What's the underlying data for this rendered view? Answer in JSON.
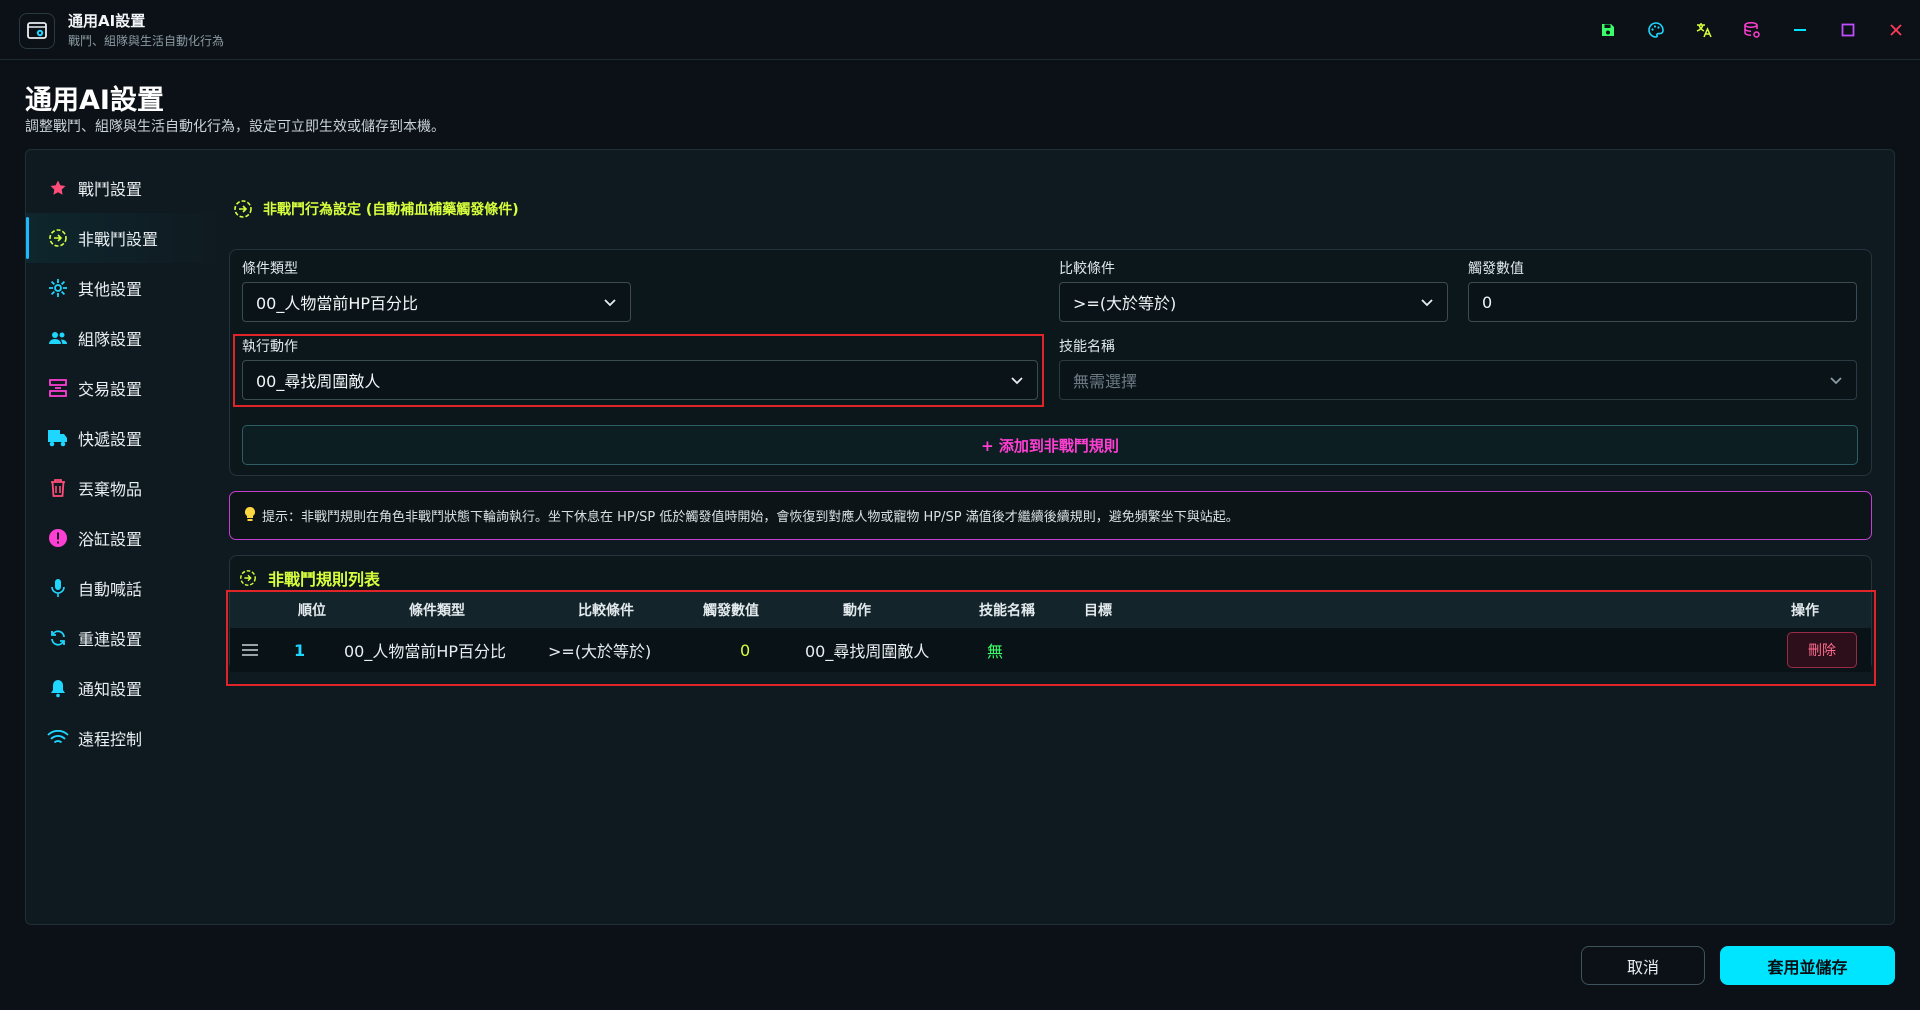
{
  "window": {
    "title": "通用AI設置",
    "subtitle": "戰鬥、組隊與生活自動化行為",
    "icons": [
      "save-icon",
      "palette-icon",
      "translate-icon",
      "database-settings-icon",
      "minimize-icon",
      "maximize-icon",
      "close-icon"
    ],
    "icon_colors": {
      "save": "#39ff6a",
      "palette": "#1fd6ff",
      "translate": "#d8ff3c",
      "database": "#ff3fd4",
      "minimize": "#00e5ff",
      "maximize": "#c04dff",
      "close": "#ff3b5c"
    }
  },
  "page": {
    "title": "通用AI設置",
    "description": "調整戰鬥、組隊與生活自動化行為，設定可立即生效或儲存到本機。"
  },
  "sidebar": {
    "active_index": 1,
    "items": [
      {
        "label": "戰鬥設置",
        "icon": "star-icon",
        "color": "#ff4d7a"
      },
      {
        "label": "非戰鬥設置",
        "icon": "circle-arrow-icon",
        "color": "#d8ff3c"
      },
      {
        "label": "其他設置",
        "icon": "gear-burst-icon",
        "color": "#1fd6ff"
      },
      {
        "label": "組隊設置",
        "icon": "group-icon",
        "color": "#1fd6ff"
      },
      {
        "label": "交易設置",
        "icon": "exchange-icon",
        "color": "#ff3fd4"
      },
      {
        "label": "快遞設置",
        "icon": "truck-icon",
        "color": "#1fd6ff"
      },
      {
        "label": "丟棄物品",
        "icon": "trash-icon",
        "color": "#ff4d7a"
      },
      {
        "label": "浴缸設置",
        "icon": "alert-icon",
        "color": "#ff3fd4"
      },
      {
        "label": "自動喊話",
        "icon": "mic-icon",
        "color": "#1fd6ff"
      },
      {
        "label": "重連設置",
        "icon": "refresh-icon",
        "color": "#1fd6ff"
      },
      {
        "label": "通知設置",
        "icon": "bell-icon",
        "color": "#1fd6ff"
      },
      {
        "label": "遠程控制",
        "icon": "wifi-icon",
        "color": "#1fd6ff"
      }
    ]
  },
  "section": {
    "title": "非戰鬥行為設定 (自動補血補藥觸發條件)"
  },
  "form": {
    "condition_type": {
      "label": "條件類型",
      "value": "00_人物當前HP百分比"
    },
    "compare": {
      "label": "比較條件",
      "value": ">=(大於等於)"
    },
    "trigger": {
      "label": "觸發數值",
      "value": "0"
    },
    "action": {
      "label": "執行動作",
      "value": "00_尋找周圍敵人"
    },
    "skill": {
      "label": "技能名稱",
      "placeholder": "無需選擇"
    },
    "add_button": "+ 添加到非戰鬥規則"
  },
  "hint": {
    "icon": "lightbulb-icon",
    "text": "提示：非戰鬥規則在角色非戰鬥狀態下輪詢執行。坐下休息在 HP/SP 低於觸發值時開始，會恢復到對應人物或寵物 HP/SP 滿值後才繼續後續規則，避免頻繁坐下與站起。"
  },
  "rules": {
    "title": "非戰鬥規則列表",
    "columns": [
      "順位",
      "條件類型",
      "比較條件",
      "觸發數值",
      "動作",
      "技能名稱",
      "目標",
      "操作"
    ],
    "rows": [
      {
        "order": "1",
        "condition": "00_人物當前HP百分比",
        "compare": ">=(大於等於)",
        "value": "0",
        "action": "00_尋找周圍敵人",
        "skill": "無",
        "target": "",
        "op": "刪除"
      }
    ]
  },
  "footer": {
    "cancel": "取消",
    "apply": "套用並儲存"
  }
}
